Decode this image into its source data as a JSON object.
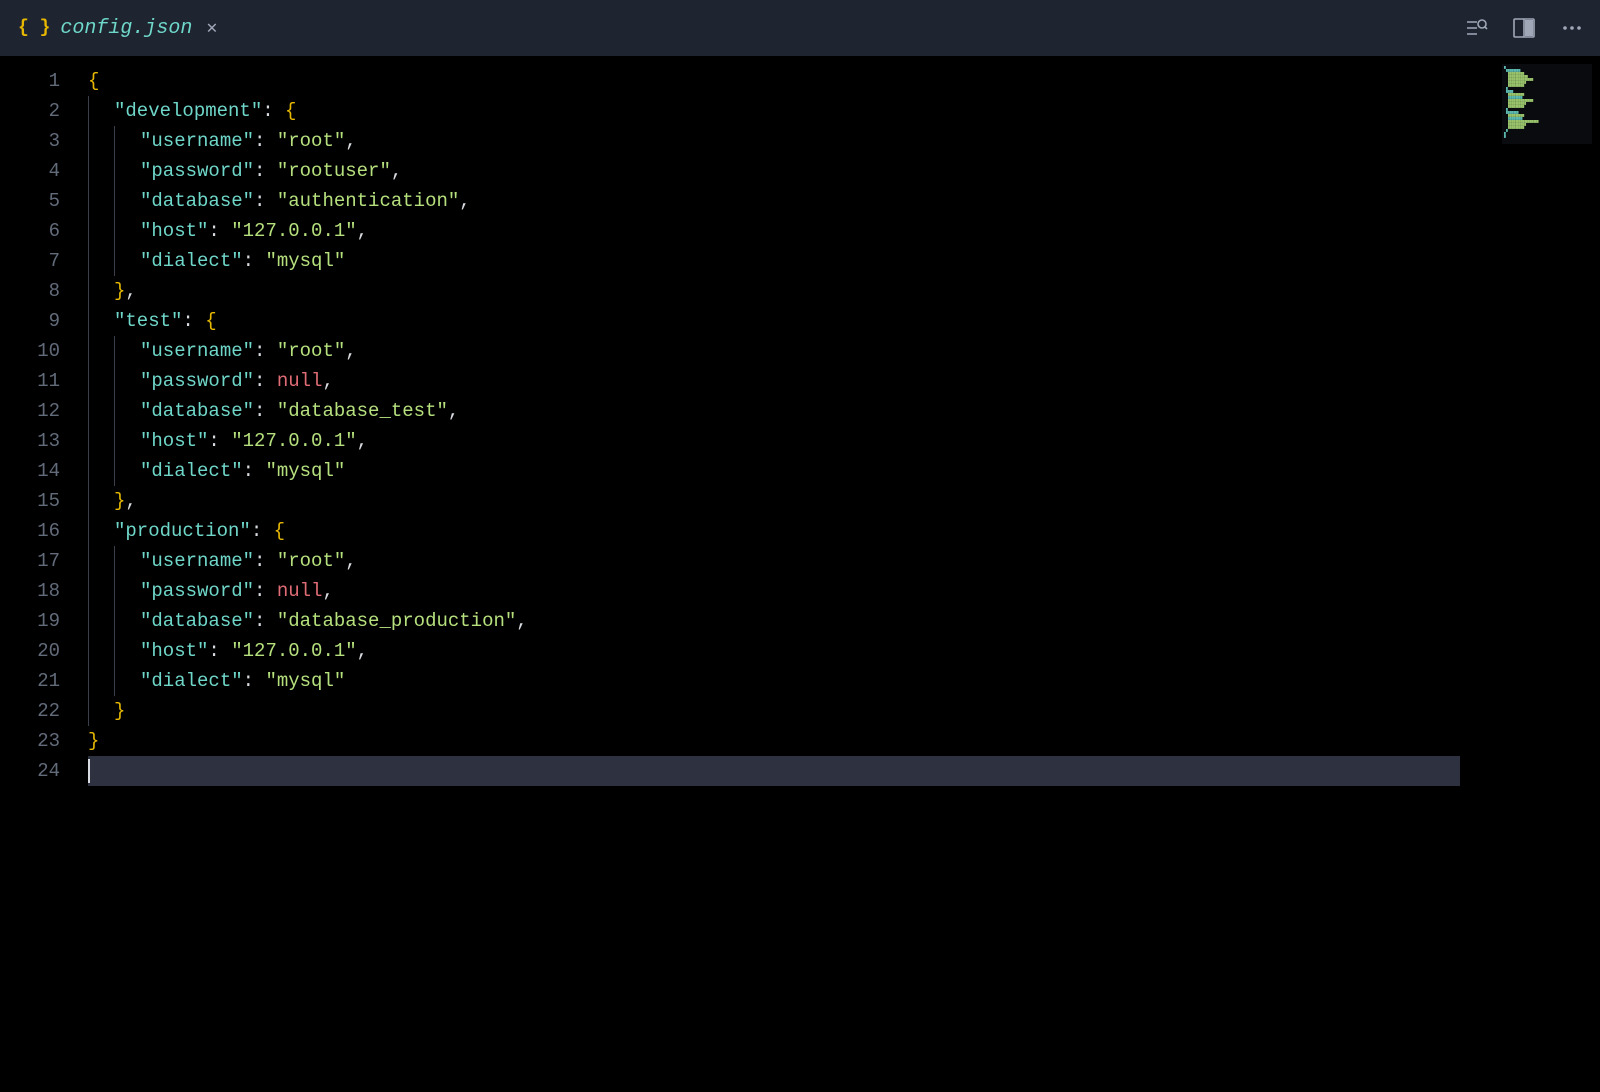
{
  "tab": {
    "filename": "config.json"
  },
  "line_numbers": [
    "1",
    "2",
    "3",
    "4",
    "5",
    "6",
    "7",
    "8",
    "9",
    "10",
    "11",
    "12",
    "13",
    "14",
    "15",
    "16",
    "17",
    "18",
    "19",
    "20",
    "21",
    "22",
    "23",
    "24"
  ],
  "code_lines": [
    {
      "indent": 1,
      "guides": [],
      "tokens": [
        {
          "t": "brace",
          "v": "{"
        }
      ]
    },
    {
      "indent": 2,
      "guides": [
        0
      ],
      "tokens": [
        {
          "t": "key",
          "v": "\"development\""
        },
        {
          "t": "colon",
          "v": ": "
        },
        {
          "t": "brace",
          "v": "{"
        }
      ]
    },
    {
      "indent": 3,
      "guides": [
        0,
        26
      ],
      "tokens": [
        {
          "t": "key",
          "v": "\"username\""
        },
        {
          "t": "colon",
          "v": ": "
        },
        {
          "t": "string",
          "v": "\"root\""
        },
        {
          "t": "punct",
          "v": ","
        }
      ]
    },
    {
      "indent": 3,
      "guides": [
        0,
        26
      ],
      "tokens": [
        {
          "t": "key",
          "v": "\"password\""
        },
        {
          "t": "colon",
          "v": ": "
        },
        {
          "t": "string",
          "v": "\"rootuser\""
        },
        {
          "t": "punct",
          "v": ","
        }
      ]
    },
    {
      "indent": 3,
      "guides": [
        0,
        26
      ],
      "tokens": [
        {
          "t": "key",
          "v": "\"database\""
        },
        {
          "t": "colon",
          "v": ": "
        },
        {
          "t": "string",
          "v": "\"authentication\""
        },
        {
          "t": "punct",
          "v": ","
        }
      ]
    },
    {
      "indent": 3,
      "guides": [
        0,
        26
      ],
      "tokens": [
        {
          "t": "key",
          "v": "\"host\""
        },
        {
          "t": "colon",
          "v": ": "
        },
        {
          "t": "string",
          "v": "\"127.0.0.1\""
        },
        {
          "t": "punct",
          "v": ","
        }
      ]
    },
    {
      "indent": 3,
      "guides": [
        0,
        26
      ],
      "tokens": [
        {
          "t": "key",
          "v": "\"dialect\""
        },
        {
          "t": "colon",
          "v": ": "
        },
        {
          "t": "string",
          "v": "\"mysql\""
        }
      ]
    },
    {
      "indent": 2,
      "guides": [
        0
      ],
      "tokens": [
        {
          "t": "brace",
          "v": "}"
        },
        {
          "t": "punct",
          "v": ","
        }
      ]
    },
    {
      "indent": 2,
      "guides": [
        0
      ],
      "tokens": [
        {
          "t": "key",
          "v": "\"test\""
        },
        {
          "t": "colon",
          "v": ": "
        },
        {
          "t": "brace",
          "v": "{"
        }
      ]
    },
    {
      "indent": 3,
      "guides": [
        0,
        26
      ],
      "tokens": [
        {
          "t": "key",
          "v": "\"username\""
        },
        {
          "t": "colon",
          "v": ": "
        },
        {
          "t": "string",
          "v": "\"root\""
        },
        {
          "t": "punct",
          "v": ","
        }
      ]
    },
    {
      "indent": 3,
      "guides": [
        0,
        26
      ],
      "tokens": [
        {
          "t": "key",
          "v": "\"password\""
        },
        {
          "t": "colon",
          "v": ": "
        },
        {
          "t": "null",
          "v": "null"
        },
        {
          "t": "punct",
          "v": ","
        }
      ]
    },
    {
      "indent": 3,
      "guides": [
        0,
        26
      ],
      "tokens": [
        {
          "t": "key",
          "v": "\"database\""
        },
        {
          "t": "colon",
          "v": ": "
        },
        {
          "t": "string",
          "v": "\"database_test\""
        },
        {
          "t": "punct",
          "v": ","
        }
      ]
    },
    {
      "indent": 3,
      "guides": [
        0,
        26
      ],
      "tokens": [
        {
          "t": "key",
          "v": "\"host\""
        },
        {
          "t": "colon",
          "v": ": "
        },
        {
          "t": "string",
          "v": "\"127.0.0.1\""
        },
        {
          "t": "punct",
          "v": ","
        }
      ]
    },
    {
      "indent": 3,
      "guides": [
        0,
        26
      ],
      "tokens": [
        {
          "t": "key",
          "v": "\"dialect\""
        },
        {
          "t": "colon",
          "v": ": "
        },
        {
          "t": "string",
          "v": "\"mysql\""
        }
      ]
    },
    {
      "indent": 2,
      "guides": [
        0
      ],
      "tokens": [
        {
          "t": "brace",
          "v": "}"
        },
        {
          "t": "punct",
          "v": ","
        }
      ]
    },
    {
      "indent": 2,
      "guides": [
        0
      ],
      "tokens": [
        {
          "t": "key",
          "v": "\"production\""
        },
        {
          "t": "colon",
          "v": ": "
        },
        {
          "t": "brace",
          "v": "{"
        }
      ]
    },
    {
      "indent": 3,
      "guides": [
        0,
        26
      ],
      "tokens": [
        {
          "t": "key",
          "v": "\"username\""
        },
        {
          "t": "colon",
          "v": ": "
        },
        {
          "t": "string",
          "v": "\"root\""
        },
        {
          "t": "punct",
          "v": ","
        }
      ]
    },
    {
      "indent": 3,
      "guides": [
        0,
        26
      ],
      "tokens": [
        {
          "t": "key",
          "v": "\"password\""
        },
        {
          "t": "colon",
          "v": ": "
        },
        {
          "t": "null",
          "v": "null"
        },
        {
          "t": "punct",
          "v": ","
        }
      ]
    },
    {
      "indent": 3,
      "guides": [
        0,
        26
      ],
      "tokens": [
        {
          "t": "key",
          "v": "\"database\""
        },
        {
          "t": "colon",
          "v": ": "
        },
        {
          "t": "string",
          "v": "\"database_production\""
        },
        {
          "t": "punct",
          "v": ","
        }
      ]
    },
    {
      "indent": 3,
      "guides": [
        0,
        26
      ],
      "tokens": [
        {
          "t": "key",
          "v": "\"host\""
        },
        {
          "t": "colon",
          "v": ": "
        },
        {
          "t": "string",
          "v": "\"127.0.0.1\""
        },
        {
          "t": "punct",
          "v": ","
        }
      ]
    },
    {
      "indent": 3,
      "guides": [
        0,
        26
      ],
      "tokens": [
        {
          "t": "key",
          "v": "\"dialect\""
        },
        {
          "t": "colon",
          "v": ": "
        },
        {
          "t": "string",
          "v": "\"mysql\""
        }
      ]
    },
    {
      "indent": 2,
      "guides": [
        0
      ],
      "tokens": [
        {
          "t": "brace",
          "v": "}"
        }
      ]
    },
    {
      "indent": 1,
      "guides": [],
      "tokens": [
        {
          "t": "brace",
          "v": "}"
        }
      ]
    },
    {
      "indent": 1,
      "guides": [],
      "tokens": []
    }
  ]
}
